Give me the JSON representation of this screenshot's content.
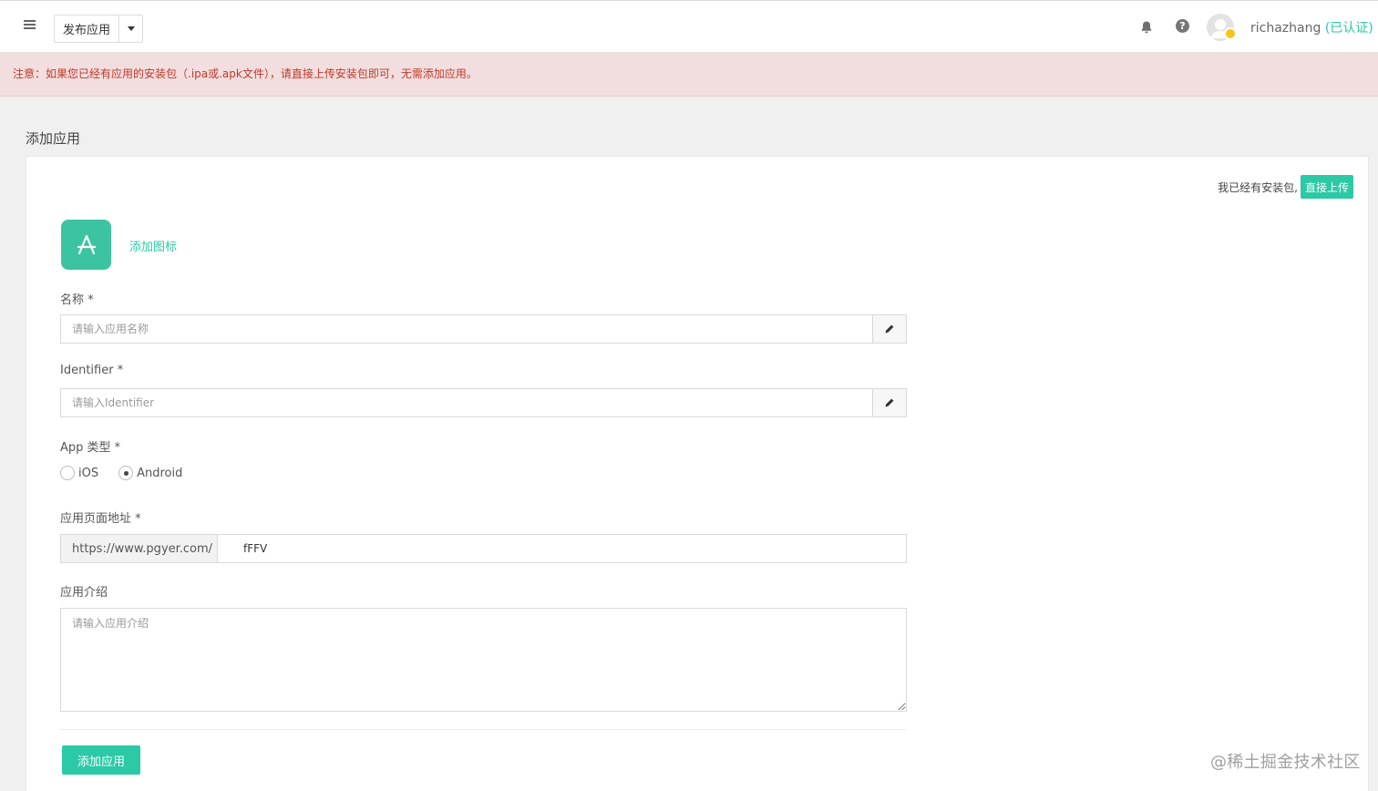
{
  "header": {
    "menu_icon": "hamburger-icon",
    "publish_label": "发布应用",
    "bell_icon": "bell-icon",
    "help_icon": "question-circle-icon",
    "help_glyph": "?",
    "username": "richazhang",
    "verified_label": "(已认证)"
  },
  "alert": {
    "text": "注意：如果您已经有应用的安装包（.ipa或.apk文件），请直接上传安装包即可，无需添加应用。"
  },
  "page": {
    "title": "添加应用"
  },
  "form": {
    "have_package_text": "我已经有安装包,",
    "direct_upload_label": "直接上传",
    "add_icon_label": "添加图标",
    "name_label": "名称 *",
    "name_placeholder": "请输入应用名称",
    "identifier_label": "Identifier *",
    "identifier_placeholder": "请输入Identifier",
    "app_type_label": "App 类型 *",
    "app_type_options": [
      "iOS",
      "Android"
    ],
    "app_type_selected": "Android",
    "page_url_label": "应用页面地址 *",
    "page_url_prefix": "https://www.pgyer.com/",
    "page_url_value": "fFFV",
    "intro_label": "应用介绍",
    "intro_placeholder": "请输入应用介绍",
    "submit_label": "添加应用"
  },
  "colors": {
    "accent": "#2bc9a5",
    "alert_bg": "#f2dede",
    "alert_text": "#c0392b"
  },
  "watermark": "@稀土掘金技术社区"
}
